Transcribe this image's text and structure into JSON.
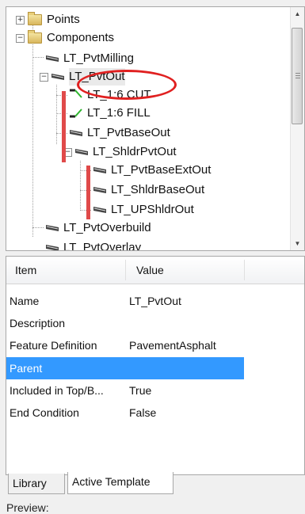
{
  "tree": {
    "items": [
      {
        "label": "Points",
        "type": "folder",
        "expander": "+"
      },
      {
        "label": "Components",
        "type": "folder",
        "expander": "−"
      },
      {
        "label": "LT_PvtMilling",
        "type": "component"
      },
      {
        "label": "LT_PvtOut",
        "type": "component",
        "expander": "−"
      },
      {
        "label": "LT_1:6 CUT",
        "type": "link"
      },
      {
        "label": "LT_1:6 FILL",
        "type": "link"
      },
      {
        "label": "LT_PvtBaseOut",
        "type": "component"
      },
      {
        "label": "LT_ShldrPvtOut",
        "type": "component",
        "expander": "−"
      },
      {
        "label": "LT_PvtBaseExtOut",
        "type": "component"
      },
      {
        "label": "LT_ShldrBaseOut",
        "type": "component"
      },
      {
        "label": "LT_UPShldrOut",
        "type": "component"
      },
      {
        "label": "LT_PvtOverbuild",
        "type": "component"
      },
      {
        "label": "LT_PvtOverlay",
        "type": "component"
      }
    ]
  },
  "properties": {
    "header": {
      "item": "Item",
      "value": "Value"
    },
    "rows": [
      {
        "name": "Name",
        "value": "LT_PvtOut",
        "selected": false
      },
      {
        "name": "Description",
        "value": "",
        "selected": false
      },
      {
        "name": "Feature Definition",
        "value": "PavementAsphalt",
        "selected": false
      },
      {
        "name": "Parent",
        "value": "",
        "selected": true
      },
      {
        "name": "Included in Top/B...",
        "value": "True",
        "selected": false
      },
      {
        "name": "End Condition",
        "value": "False",
        "selected": false
      }
    ]
  },
  "tabs": [
    {
      "label": "Library",
      "active": false
    },
    {
      "label": "Active Template",
      "active": true
    }
  ],
  "preview_label": "Preview:",
  "colors": {
    "selection": "#3399ff",
    "annotation_red": "#e02020",
    "link_green": "#2db52d"
  }
}
